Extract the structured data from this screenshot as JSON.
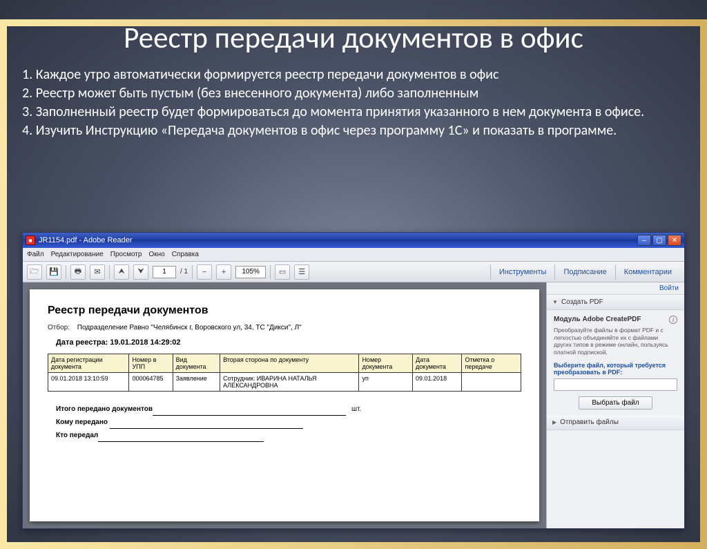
{
  "slide": {
    "title": "Реестр передачи документов в офис",
    "p1": "1. Каждое утро автоматически формируется реестр передачи документов  в офис",
    "p2": "2. Реестр может быть  пустым (без  внесенного документа)  либо заполненным",
    "p3": "3. Заполненный реестр будет формироваться до момента принятия указанного в нем документа в офисе.",
    "p4": "4. Изучить Инструкцию «Передача документов в офис через программу 1С» и показать в программе."
  },
  "reader": {
    "titlebar": "JR1154.pdf - Adobe Reader",
    "menu": [
      "Файл",
      "Редактирование",
      "Просмотр",
      "Окно",
      "Справка"
    ],
    "page_current": "1",
    "page_total": "/ 1",
    "zoom": "105%",
    "right_tabs": [
      "Инструменты",
      "Подписание",
      "Комментарии"
    ]
  },
  "doc": {
    "heading": "Реестр передачи документов",
    "filter_label": "Отбор:",
    "filter_value": "Подразделение Равно \"Челябинск г, Воровского ул, 34, ТС \"Дикси\", Л\"",
    "date_line": "Дата реестра: 19.01.2018 14:29:02",
    "columns": [
      "Дата регистрации документа",
      "Номер в УПП",
      "Вид документа",
      "Вторая сторона по документу",
      "Номер документа",
      "Дата документа",
      "Отметка о передаче"
    ],
    "row": [
      "09.01.2018 13:10:59",
      "000064785",
      "Заявление",
      "Сотрудник: ИВАРИНА НАТАЛЬЯ АЛЕКСАНДРОВНА",
      "уп",
      "09.01.2018",
      ""
    ],
    "sum_total": "Итого передано документов",
    "sum_unit": "шт.",
    "sum_to": "Кому передано",
    "sum_from": "Кто передал"
  },
  "side": {
    "login": "Войти",
    "acc1": "Создать PDF",
    "module_name": "Модуль Adobe CreatePDF",
    "module_desc": "Преобразуйте файлы в формат PDF и с легкостью объединяйте их с файлами других типов в режиме онлайн, пользуясь платной подпиской.",
    "hint": "Выберите файл, который требуется преобразовать в PDF:",
    "choose_btn": "Выбрать файл",
    "acc2": "Отправить файлы"
  }
}
